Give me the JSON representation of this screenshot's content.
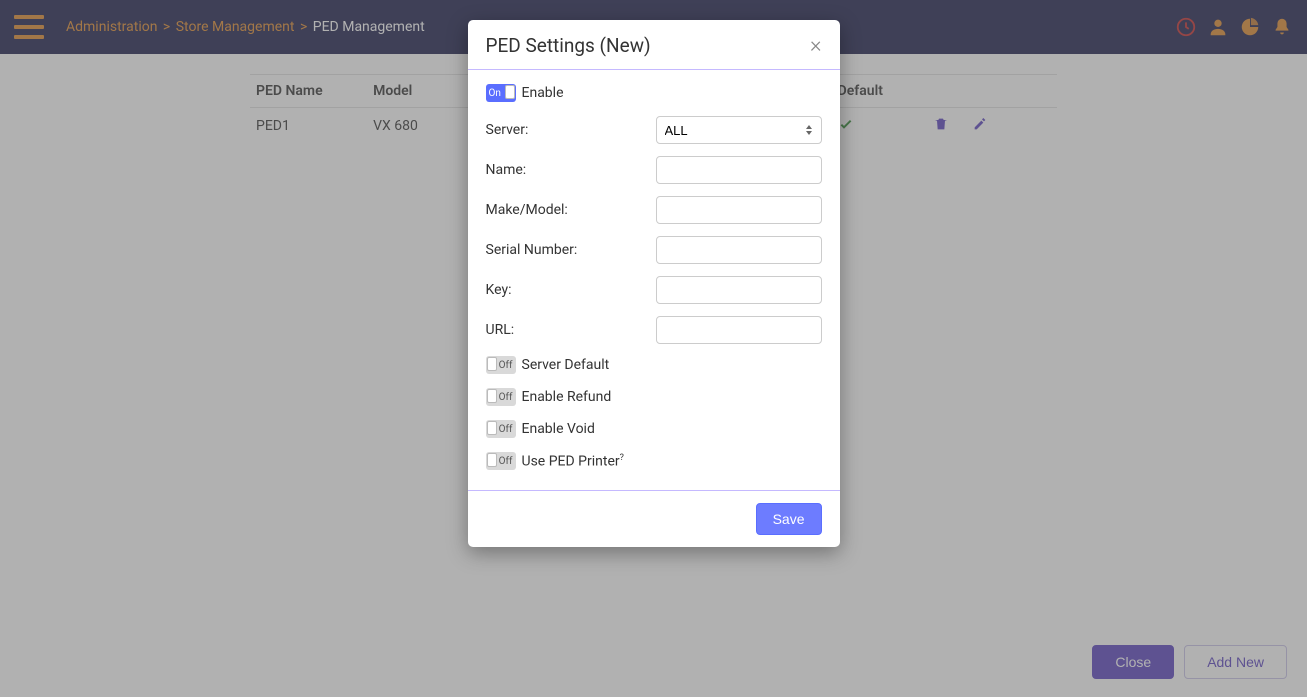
{
  "header": {
    "breadcrumb": {
      "admin": "Administration",
      "store": "Store Management",
      "current": "PED Management"
    }
  },
  "table": {
    "headers": {
      "name": "PED Name",
      "model": "Model",
      "default": "Default"
    },
    "rows": [
      {
        "name": "PED1",
        "model": "VX 680"
      }
    ]
  },
  "footer": {
    "close": "Close",
    "add_new": "Add New"
  },
  "modal": {
    "title": "PED Settings (New)",
    "toggles": {
      "enable": {
        "state": "On",
        "label": "Enable"
      },
      "server_default": {
        "state": "Off",
        "label": "Server Default"
      },
      "enable_refund": {
        "state": "Off",
        "label": "Enable Refund"
      },
      "enable_void": {
        "state": "Off",
        "label": "Enable Void"
      },
      "use_printer": {
        "state": "Off",
        "label": "Use PED Printer"
      }
    },
    "fields": {
      "server": {
        "label": "Server:",
        "value": "ALL"
      },
      "name": {
        "label": "Name:"
      },
      "model": {
        "label": "Make/Model:"
      },
      "serial": {
        "label": "Serial Number:"
      },
      "key": {
        "label": "Key:"
      },
      "url": {
        "label": "URL:"
      }
    },
    "save": "Save"
  }
}
